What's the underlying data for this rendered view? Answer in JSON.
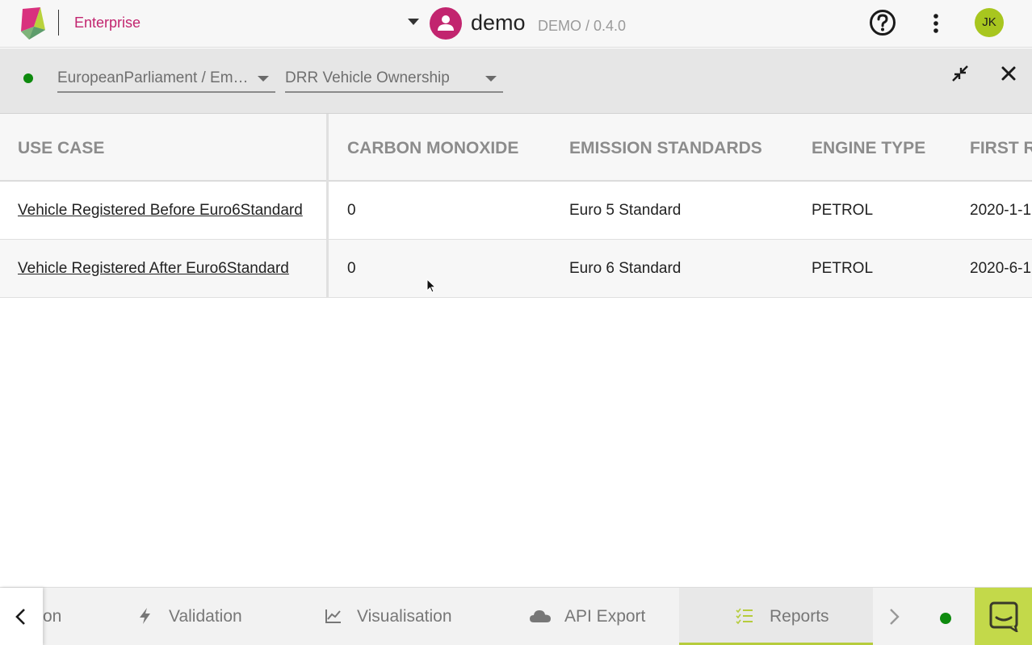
{
  "header": {
    "edition": "Enterprise",
    "project_name": "demo",
    "project_version": "DEMO / 0.4.0",
    "user_initials": "JK",
    "colors": {
      "brand": "#c2256f",
      "user_avatar": "#a8c61f"
    }
  },
  "filters": {
    "status": "online",
    "selects": [
      {
        "value": "EuropeanParliament / Em…"
      },
      {
        "value": "DRR Vehicle Ownership"
      }
    ]
  },
  "table": {
    "columns": [
      "USE CASE",
      "CARBON MONOXIDE",
      "EMISSION STANDARDS",
      "ENGINE TYPE",
      "FIRST R"
    ],
    "rows": [
      {
        "use_case": "Vehicle Registered Before Euro6Standard",
        "carbon_monoxide": "0",
        "emission_standards": "Euro 5 Standard",
        "engine_type": "PETROL",
        "first_r": "2020-1-1"
      },
      {
        "use_case": "Vehicle Registered After Euro6Standard",
        "carbon_monoxide": "0",
        "emission_standards": "Euro 6 Standard",
        "engine_type": "PETROL",
        "first_r": "2020-6-1"
      }
    ]
  },
  "bottom_nav": {
    "tabs": [
      {
        "label": "on",
        "icon": ""
      },
      {
        "label": "Validation",
        "icon": "bolt-icon"
      },
      {
        "label": "Visualisation",
        "icon": "line-chart-icon"
      },
      {
        "label": "API Export",
        "icon": "cloud-icon"
      },
      {
        "label": "Reports",
        "icon": "checklist-icon",
        "active": true
      }
    ],
    "accent": "#b6cc3c"
  }
}
